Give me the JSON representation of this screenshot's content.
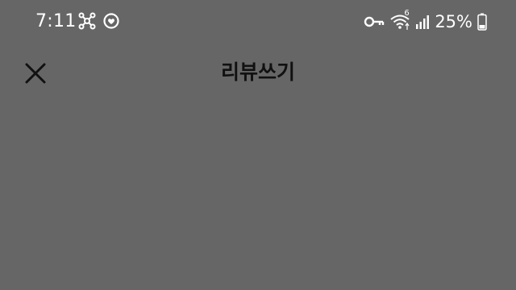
{
  "status_bar": {
    "time": "7:11",
    "battery_percent": "25%",
    "icons_left": [
      "network-hub-icon",
      "heart-circle-icon"
    ],
    "icons_right": [
      "key-icon",
      "wifi-icon",
      "signal-icon",
      "battery-icon"
    ],
    "wifi_badge": "6"
  },
  "header": {
    "title": "리뷰쓰기",
    "close_icon": "close-icon"
  },
  "colors": {
    "background": "#666666",
    "status_text": "#ffffff",
    "title_text": "#111111"
  }
}
